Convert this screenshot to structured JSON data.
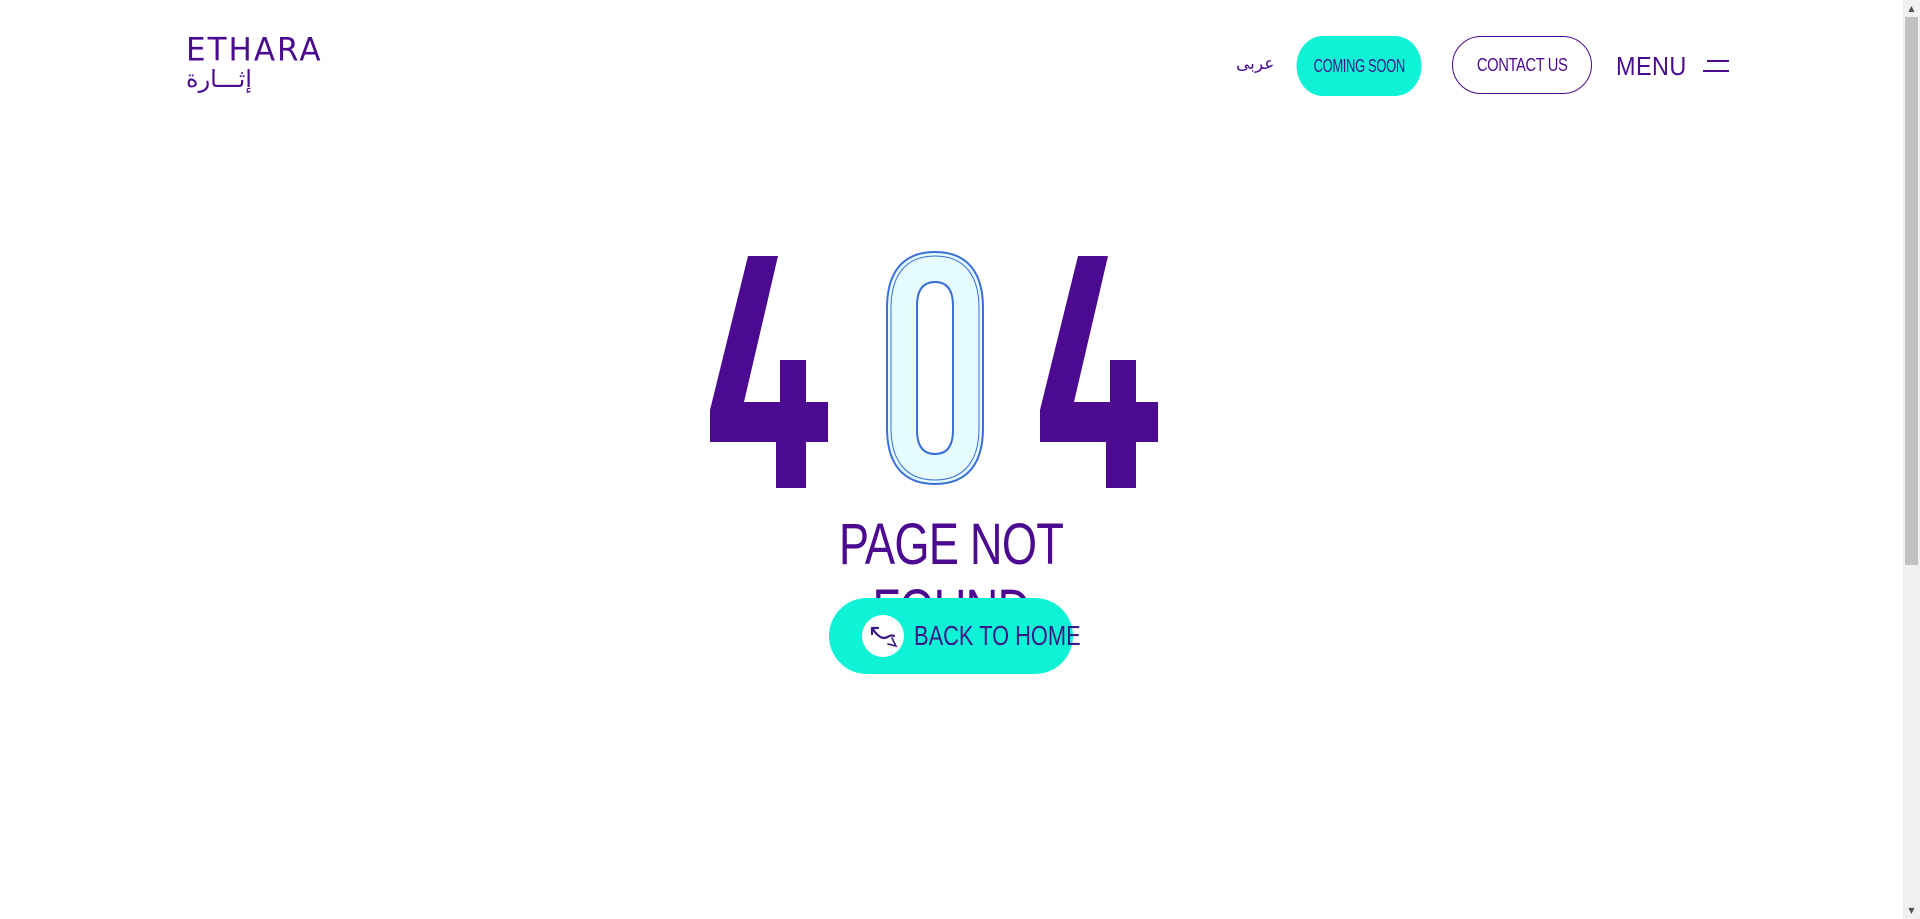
{
  "header": {
    "logo_latin": "ETHARA",
    "logo_arabic": "إثـــارة",
    "language_link": "عربى",
    "coming_soon_label": "COMING SOON",
    "contact_label": "CONTACT US",
    "menu_label": "MENU"
  },
  "main": {
    "error_digits": [
      "4",
      "0",
      "4"
    ],
    "title": "PAGE NOT FOUND",
    "back_home_label": "BACK TO HOME"
  },
  "colors": {
    "brand_purple": "#4b0a8f",
    "accent_cyan": "#0ff2d6",
    "outline_blue": "#3a6fd8",
    "zero_fill": "#e6fbfb"
  },
  "icons": {
    "menu": "hamburger-icon",
    "back_home": "curved-arrow-icon",
    "scroll_up": "arrow-up-icon",
    "scroll_down": "arrow-down-icon"
  }
}
